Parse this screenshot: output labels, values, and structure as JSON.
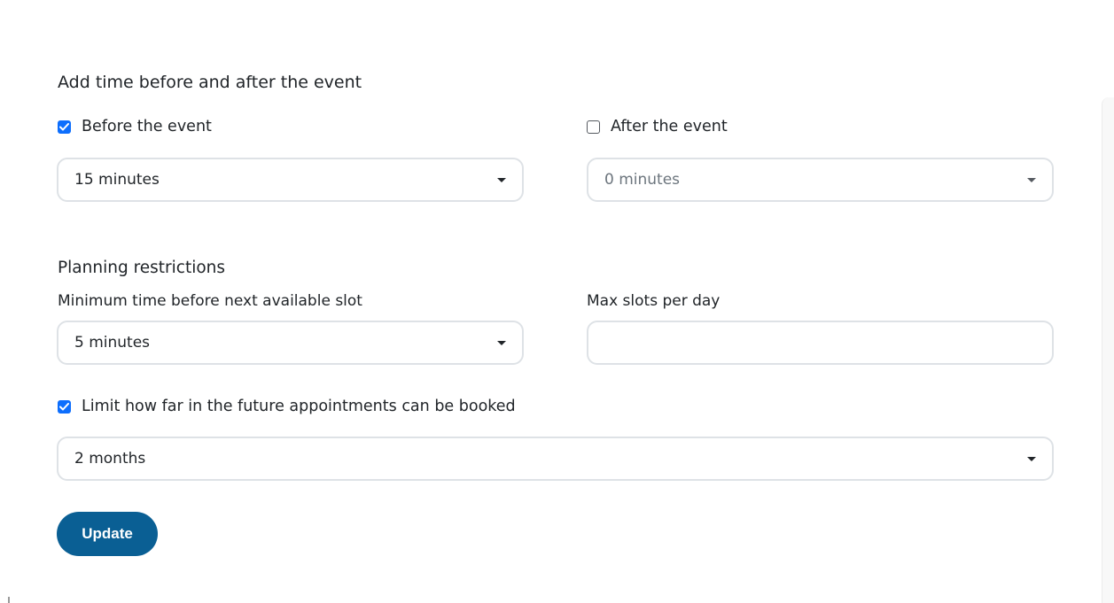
{
  "buffer": {
    "title": "Add time before and after the event",
    "before": {
      "label": "Before the event",
      "checked": true,
      "value": "15 minutes"
    },
    "after": {
      "label": "After the event",
      "checked": false,
      "value": "0 minutes"
    }
  },
  "restrictions": {
    "title": "Planning restrictions",
    "min_time": {
      "label": "Minimum time before next available slot",
      "value": "5 minutes"
    },
    "max_slots": {
      "label": "Max slots per day",
      "value": ""
    },
    "limit_future": {
      "label": "Limit how far in the future appointments can be booked",
      "checked": true,
      "value": "2 months"
    }
  },
  "actions": {
    "update_label": "Update"
  },
  "colors": {
    "primary_button": "#0a5f94",
    "checkbox_checked": "#0d6efd",
    "border": "#dee2e6"
  }
}
